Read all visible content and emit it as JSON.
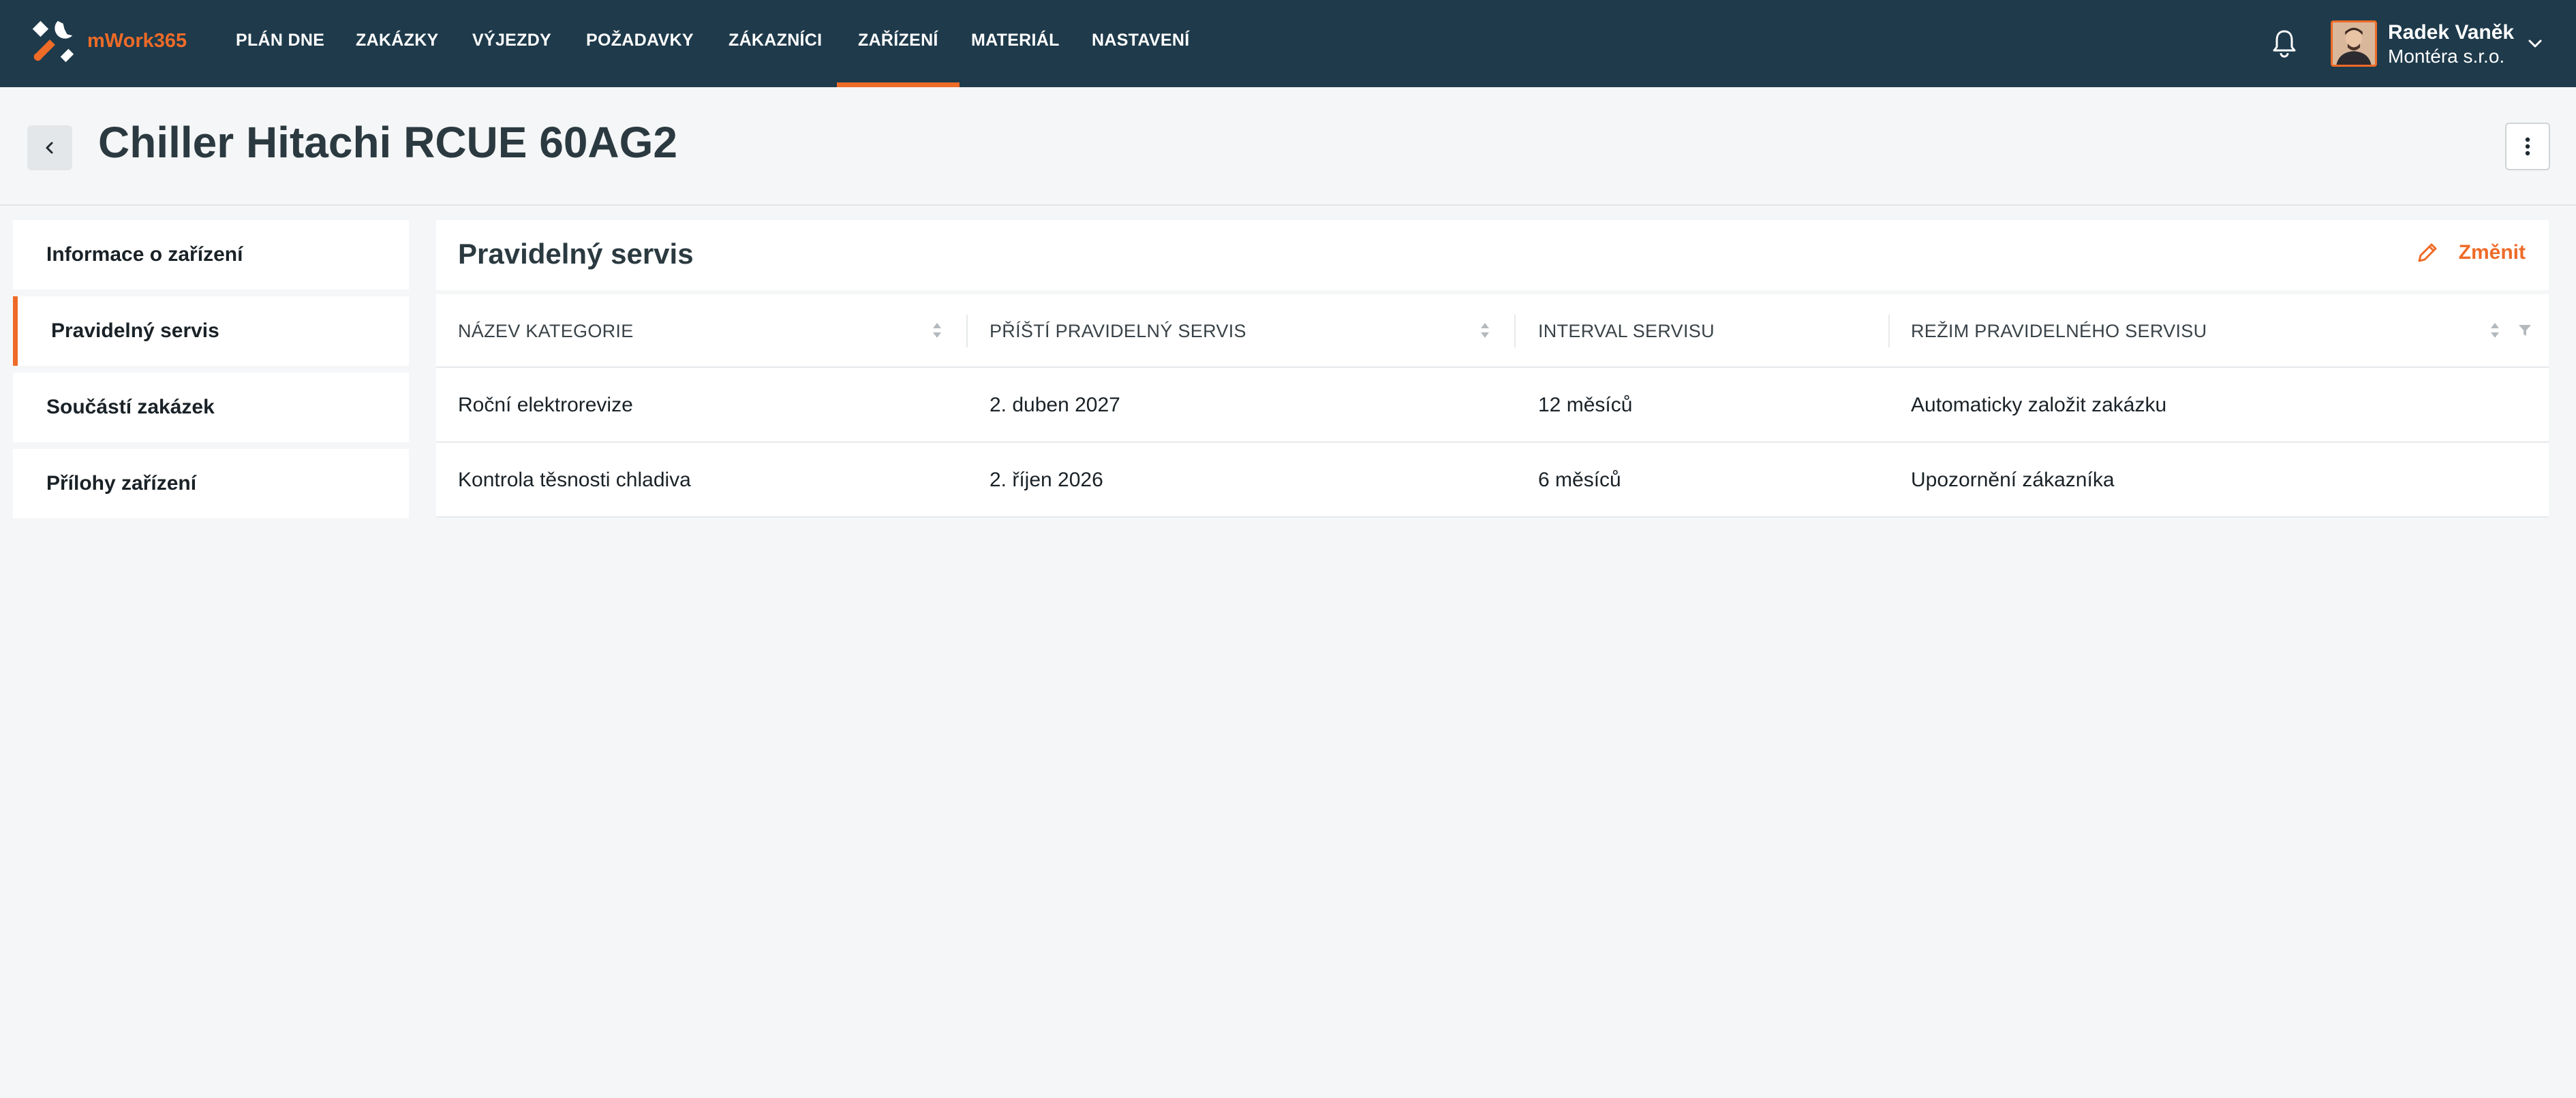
{
  "brand": {
    "name": "mWork365",
    "accent": "#ee6b28",
    "topbar_bg": "#1e3a4b"
  },
  "nav": {
    "items": [
      {
        "label": "PLÁN DNE"
      },
      {
        "label": "ZAKÁZKY"
      },
      {
        "label": "VÝJEZDY"
      },
      {
        "label": "POŽADAVKY"
      },
      {
        "label": "ZÁKAZNÍCI"
      },
      {
        "label": "ZAŘÍZENÍ",
        "active": true
      },
      {
        "label": "MATERIÁL"
      },
      {
        "label": "NASTAVENÍ"
      }
    ]
  },
  "user": {
    "name": "Radek Vaněk",
    "company": "Montéra s.r.o."
  },
  "icons": {
    "back": "chevron-left-icon",
    "menu": "more-vertical-icon",
    "notifications": "bell-icon",
    "edit": "pencil-icon",
    "sort": "sort-icon",
    "filter": "filter-icon"
  },
  "page": {
    "title": "Chiller Hitachi RCUE 60AG2"
  },
  "sidebar": {
    "items": [
      {
        "label": "Informace o zařízení"
      },
      {
        "label": "Pravidelný servis",
        "active": true
      },
      {
        "label": "Součástí zakázek"
      },
      {
        "label": "Přílohy zařízení"
      }
    ]
  },
  "panel": {
    "title": "Pravidelný servis",
    "edit_label": "Změnit",
    "columns": [
      "NÁZEV KATEGORIE",
      "PŘÍŠTÍ PRAVIDELNÝ SERVIS",
      "INTERVAL SERVISU",
      "REŽIM PRAVIDELNÉHO SERVISU"
    ],
    "rows": [
      {
        "category": "Roční elektrorevize",
        "next": "2. duben 2027",
        "interval": "12 měsíců",
        "mode": "Automaticky založit zakázku"
      },
      {
        "category": "Kontrola těsnosti chladiva",
        "next": "2. říjen 2026",
        "interval": "6 měsíců",
        "mode": "Upozornění zákazníka"
      }
    ]
  }
}
